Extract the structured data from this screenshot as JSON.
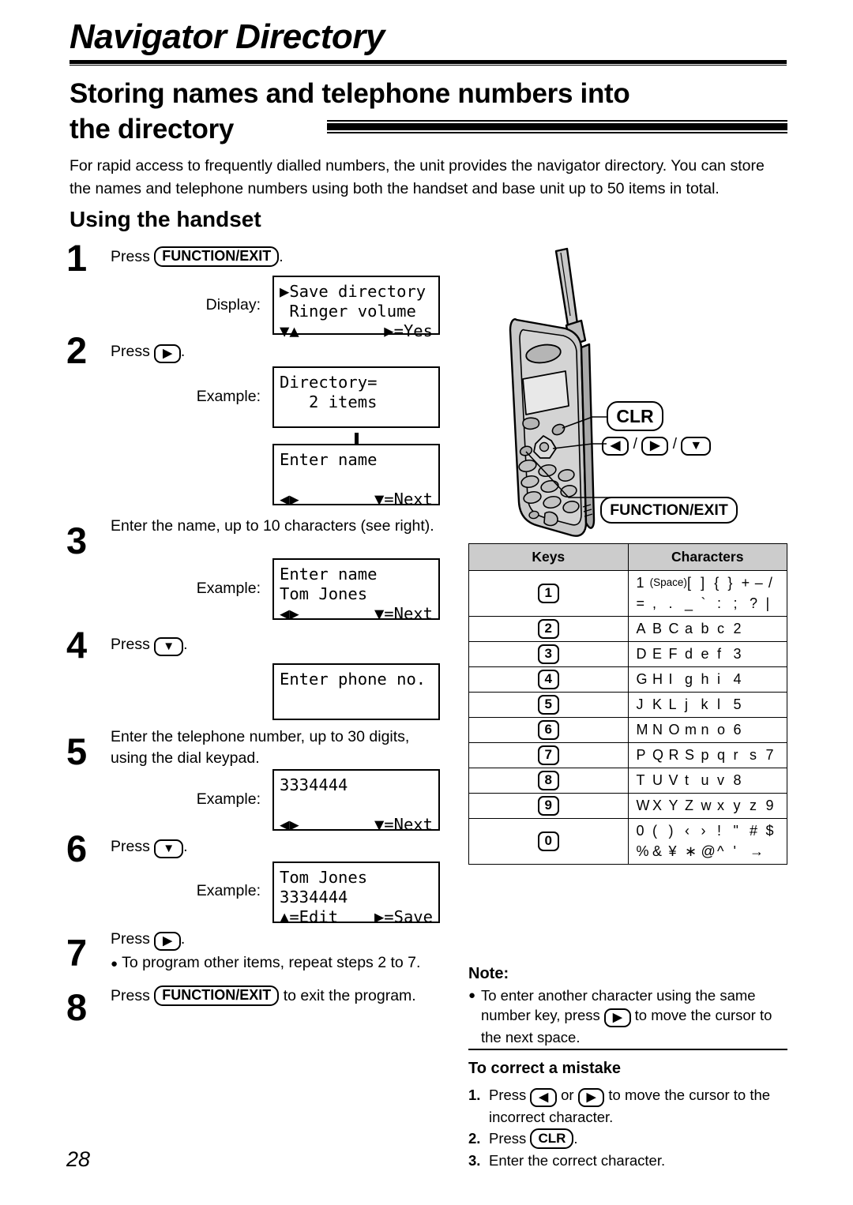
{
  "header": {
    "chapter_title": "Navigator Directory",
    "section_title": "Storing names and telephone numbers into the directory",
    "intro": "For rapid access to frequently dialled numbers, the unit provides the navigator directory. You can store the names and telephone numbers using both the handset and base unit up to 50 items in total.",
    "subhead": "Using the handset"
  },
  "steps": {
    "s1": {
      "num": "1",
      "text_before": "Press",
      "key": "FUNCTION/EXIT",
      "text_after": ".",
      "label": "Display:"
    },
    "s2": {
      "num": "2",
      "text_before": "Press",
      "key": "▶",
      "text_after": ".",
      "label": "Example:"
    },
    "s3": {
      "num": "3",
      "text": "Enter the name, up to 10 characters (see right).",
      "label": "Example:"
    },
    "s4": {
      "num": "4",
      "text_before": "Press",
      "key": "▼",
      "text_after": "."
    },
    "s5": {
      "num": "5",
      "text": "Enter the telephone number, up to 30 digits, using the dial keypad.",
      "label": "Example:"
    },
    "s6": {
      "num": "6",
      "text_before": "Press",
      "key": "▼",
      "text_after": ".",
      "label": "Example:"
    },
    "s7": {
      "num": "7",
      "text_before": "Press",
      "key": "▶",
      "text_after": ".",
      "bullet": "To program other items, repeat steps 2 to 7."
    },
    "s8": {
      "num": "8",
      "text_before": "Press",
      "key": "FUNCTION/EXIT",
      "text_after": "to exit the program."
    }
  },
  "lcd": {
    "d1": {
      "line1": "▶Save directory",
      "line2": " Ringer volume",
      "line3_left": "▼▲",
      "line3_right": "▶=Yes"
    },
    "d2": {
      "line1": "Directory=",
      "line2": "   2 items"
    },
    "d3": {
      "line1": "Enter name",
      "line2": "",
      "line3_left": "◀▶",
      "line3_right": "▼=Next"
    },
    "d4": {
      "line1": "Enter name",
      "line2": "Tom Jones",
      "line3_left": "◀▶",
      "line3_right": "▼=Next"
    },
    "d5": {
      "line1": "Enter phone no.",
      "line2": ""
    },
    "d6": {
      "line1": "3334444",
      "line2": "",
      "line3_left": "◀▶",
      "line3_right": "▼=Next"
    },
    "d7": {
      "line1": "Tom Jones",
      "line2": "3334444",
      "line3_left": "▲=Edit",
      "line3_right": "▶=Save"
    }
  },
  "handset": {
    "callout_clr": "CLR",
    "callout_nav": "◀ / ▶ / ▼",
    "callout_function": "FUNCTION/EXIT"
  },
  "table": {
    "header_keys": "Keys",
    "header_characters": "Characters",
    "rows": [
      {
        "key": "1",
        "line1": [
          "1",
          "(Space)",
          "[",
          "]",
          "{",
          "}",
          "+",
          "–",
          "/"
        ],
        "line2": [
          "=",
          ",",
          ".",
          "_",
          "`",
          ":",
          ";",
          "?",
          "|"
        ]
      },
      {
        "key": "2",
        "line1": [
          "A",
          "B",
          "C",
          "a",
          "b",
          "c",
          "2",
          "",
          ""
        ]
      },
      {
        "key": "3",
        "line1": [
          "D",
          "E",
          "F",
          "d",
          "e",
          "f",
          "3",
          "",
          ""
        ]
      },
      {
        "key": "4",
        "line1": [
          "G",
          "H",
          "I",
          "g",
          "h",
          "i",
          "4",
          "",
          ""
        ]
      },
      {
        "key": "5",
        "line1": [
          "J",
          "K",
          "L",
          "j",
          "k",
          "l",
          "5",
          "",
          ""
        ]
      },
      {
        "key": "6",
        "line1": [
          "M",
          "N",
          "O",
          "m",
          "n",
          "o",
          "6",
          "",
          ""
        ]
      },
      {
        "key": "7",
        "line1": [
          "P",
          "Q",
          "R",
          "S",
          "p",
          "q",
          "r",
          "s",
          "7"
        ]
      },
      {
        "key": "8",
        "line1": [
          "T",
          "U",
          "V",
          "t",
          "u",
          "v",
          "8",
          "",
          ""
        ]
      },
      {
        "key": "9",
        "line1": [
          "W",
          "X",
          "Y",
          "Z",
          "w",
          "x",
          "y",
          "z",
          "9"
        ]
      },
      {
        "key": "0",
        "line1": [
          "0",
          "(",
          ")",
          "‹",
          "›",
          "!",
          "\"",
          "#",
          "$"
        ],
        "line2": [
          "%",
          "&",
          "¥",
          "∗",
          "@",
          "^",
          "'",
          "→",
          ""
        ]
      }
    ]
  },
  "note": {
    "title": "Note:",
    "bullet_a": "To enter another character using the same number key, press",
    "bullet_key": "▶",
    "bullet_b": "to move the cursor to the next space."
  },
  "correct": {
    "title": "To correct a mistake",
    "item1_a": "Press",
    "item1_key1": "◀",
    "item1_or": "or",
    "item1_key2": "▶",
    "item1_b": "to move the cursor to the incorrect character.",
    "item2_a": "Press",
    "item2_key": "CLR",
    "item2_b": ".",
    "item3": "Enter the correct character."
  },
  "footer": {
    "page_number": "28"
  }
}
